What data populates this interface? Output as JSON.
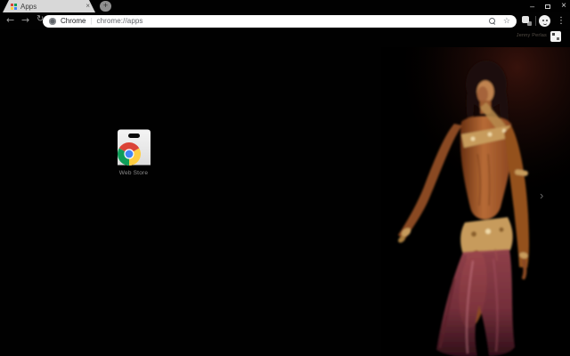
{
  "window": {
    "tab": {
      "icon": "apps-grid-icon",
      "title": "Apps",
      "close_glyph": "×"
    },
    "new_tab_glyph": "+",
    "controls": {
      "minimize_glyph": "–",
      "maximize": "restore-box",
      "close_glyph": "×"
    }
  },
  "toolbar": {
    "back_glyph": "←",
    "forward_glyph": "→",
    "reload_glyph": "↻",
    "omnibox": {
      "site_label": "Chrome",
      "separator": "|",
      "url": "chrome://apps",
      "search_icon": "magnifier-icon",
      "bookmark_glyph": "☆"
    },
    "menu_glyph": "⋮"
  },
  "page": {
    "watermark_text": "Jenny Perlas",
    "watermark_logo": "white-square-logo",
    "app": {
      "label": "Web Store",
      "icon": "chrome-web-store-bag-icon"
    },
    "next_page_glyph": "›",
    "background_art": "male-dancer-in-gold-oriental-costume-on-dark-stage"
  },
  "colors": {
    "frame": "#000000",
    "tab_fill": "#d8d8d8",
    "omnibox_fill": "#ffffff",
    "url_text": "#5f6368",
    "page_bg": "#010101",
    "logo_red": "#db4437",
    "logo_green": "#0f9d58",
    "logo_yellow": "#ffcd40",
    "logo_blue": "#4285f4",
    "bag_gray": "#ececec",
    "costume_gold": "#c79b5c",
    "fabric_red": "#7e3340",
    "skin_tone": "#b76b36"
  }
}
